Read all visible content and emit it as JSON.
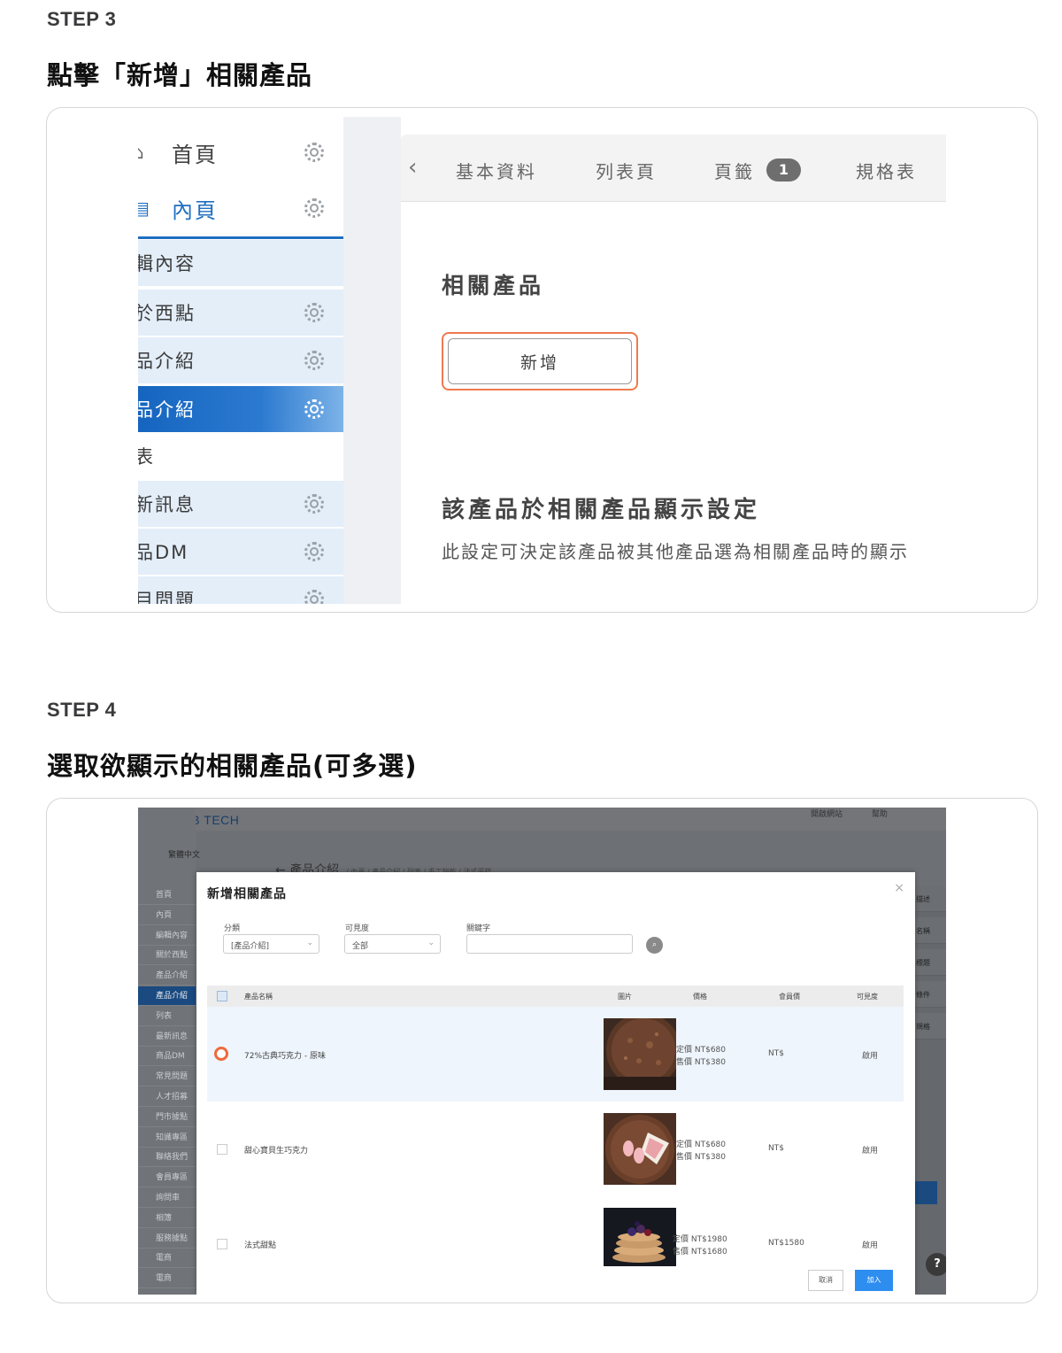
{
  "step3": {
    "label": "STEP 3",
    "title": "點擊「新增」相關產品",
    "sidebar": {
      "top_items": [
        {
          "label": "首頁",
          "icon": "home-icon",
          "active": false
        },
        {
          "label": "內頁",
          "icon": "page-icon",
          "active": true
        }
      ],
      "sub_items": [
        {
          "label": "輯內容",
          "gear": false,
          "style": "light"
        },
        {
          "label": "於西點",
          "gear": true,
          "style": "light"
        },
        {
          "label": "品介紹",
          "gear": true,
          "style": "light"
        },
        {
          "label": "品介紹",
          "gear": true,
          "style": "active"
        },
        {
          "label": "表",
          "gear": false,
          "style": "white"
        },
        {
          "label": "新訊息",
          "gear": true,
          "style": "light"
        },
        {
          "label": "品DM",
          "gear": true,
          "style": "light"
        },
        {
          "label": "目問題",
          "gear": true,
          "style": "light"
        }
      ]
    },
    "tabs": [
      {
        "label": "基本資料"
      },
      {
        "label": "列表頁"
      },
      {
        "label": "頁籤"
      },
      {
        "label": "規格表"
      }
    ],
    "tab_badge": "1",
    "section_title": "相關產品",
    "add_button": "新增",
    "display_title": "該產品於相關產品顯示設定",
    "display_desc": "此設定可決定該產品被其他產品選為相關產品時的顯示"
  },
  "step4": {
    "label": "STEP 4",
    "title": "選取欲顯示的相關產品(可多選)",
    "background": {
      "brand": "WEB TECH",
      "language": "繁體中文",
      "breadcrumb_title": "產品介紹",
      "breadcrumb_path": "/ 內頁 / 產品介紹 / 列表 / 手工餅乾 / 法式蛋糕",
      "top_right": "開啟網站",
      "top_right_2": "幫助",
      "side_items": [
        {
          "label": "首頁",
          "active": false
        },
        {
          "label": "內頁",
          "active": false
        },
        {
          "label": "編輯內容",
          "active": false
        },
        {
          "label": "關於西點",
          "active": false
        },
        {
          "label": "產品介紹",
          "active": false
        },
        {
          "label": "產品介紹",
          "active": true
        },
        {
          "label": "列表",
          "active": false
        },
        {
          "label": "最新訊息",
          "active": false
        },
        {
          "label": "商品DM",
          "active": false
        },
        {
          "label": "常見問題",
          "active": false
        },
        {
          "label": "人才招募",
          "active": false
        },
        {
          "label": "門市據點",
          "active": false
        },
        {
          "label": "知識專區",
          "active": false
        },
        {
          "label": "聯絡我們",
          "active": false
        },
        {
          "label": "會員專區",
          "active": false
        },
        {
          "label": "詢問車",
          "active": false
        },
        {
          "label": "相簿",
          "active": false
        },
        {
          "label": "服務據點",
          "active": false
        },
        {
          "label": "電商",
          "active": false
        },
        {
          "label": "電商",
          "active": false
        }
      ],
      "right_items": [
        "描述",
        "名稱",
        "標題",
        "條件",
        "規格"
      ]
    },
    "modal": {
      "title": "新增相關產品",
      "close": "×",
      "filters": {
        "category_label": "分類",
        "category_value": "[產品介紹]",
        "visibility_label": "可見度",
        "visibility_value": "全部",
        "keyword_label": "關鍵字",
        "keyword_value": ""
      },
      "columns": [
        "產品名稱",
        "圖片",
        "價格",
        "會員價",
        "可見度"
      ],
      "rows": [
        {
          "name": "72%古典巧克力 - 原味",
          "list_price": "定價 NT$680",
          "sale_price": "售價 NT$380",
          "member_price": "NT$",
          "visibility": "啟用",
          "selected": true
        },
        {
          "name": "甜心寶貝生巧克力",
          "list_price": "定價 NT$680",
          "sale_price": "售價 NT$380",
          "member_price": "NT$",
          "visibility": "啟用",
          "selected": false
        },
        {
          "name": "法式甜點",
          "list_price": "定價 NT$1980",
          "sale_price": "售價 NT$1680",
          "member_price": "NT$1580",
          "visibility": "啟用",
          "selected": false
        }
      ],
      "cancel_label": "取消",
      "add_label": "加入"
    }
  },
  "colors": {
    "highlight": "#ef6a3a",
    "primary_blue": "#1565c0",
    "add_blue": "#2e8ef0"
  }
}
